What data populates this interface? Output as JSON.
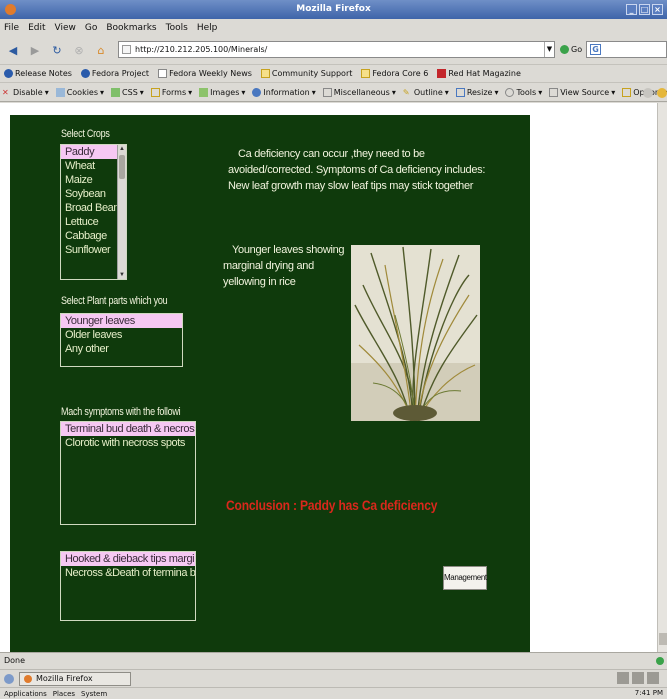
{
  "window": {
    "title": "Mozilla Firefox"
  },
  "menu": [
    "File",
    "Edit",
    "View",
    "Go",
    "Bookmarks",
    "Tools",
    "Help"
  ],
  "nav": {
    "url": "http://210.212.205.100/Minerals/",
    "go_label": "Go",
    "search_icon_label": "G"
  },
  "bookmarks": [
    "Release Notes",
    "Fedora Project",
    "Fedora Weekly News",
    "Community Support",
    "Fedora Core 6",
    "Red Hat Magazine"
  ],
  "devtoolbar": [
    "Disable",
    "Cookies",
    "CSS",
    "Forms",
    "Images",
    "Information",
    "Miscellaneous",
    "Outline",
    "Resize",
    "Tools",
    "View Source",
    "Options"
  ],
  "page": {
    "crops_label": "Select Crops",
    "crops": [
      "Paddy",
      "Wheat",
      "Maize",
      "Soybean",
      "Broad Bean",
      "Lettuce",
      "Cabbage",
      "Sunflower"
    ],
    "crops_selected": "Paddy",
    "parts_label": "Select Plant parts which you",
    "parts": [
      "Younger leaves",
      "Older leaves",
      "Any other"
    ],
    "parts_selected": "Younger leaves",
    "symptoms_label": "Mach symptoms with the followi",
    "symptoms": [
      "Terminal bud death & necross",
      "Clorotic with necross spots"
    ],
    "symptoms_selected": "Terminal bud death & necross",
    "symptoms2": [
      "Hooked & dieback tips margins",
      "Necross &Death of termina bud"
    ],
    "symptoms2_selected": "Hooked & dieback tips margins",
    "info_line1": "Ca deficiency can occur ,they need to be",
    "info_line2": "avoided/corrected. Symptoms of Ca deficiency includes:",
    "info_line3": "New leaf growth may slow  leaf tips may stick together",
    "caption_line1": "Younger leaves showing",
    "caption_line2": "marginal  drying and",
    "caption_line3": "yellowing in rice",
    "conclusion": "Conclusion : Paddy has Ca deficiency",
    "management_button": "Management"
  },
  "status": {
    "text": "Done"
  },
  "taskbar": {
    "window_button": "Mozilla Firefox",
    "panel_items": [
      "Applications",
      "Places",
      "System"
    ],
    "clock": "7:41 PM"
  },
  "colors": {
    "page_bg": "#0f3a0c",
    "selected": "#f6c8f3",
    "conclusion": "#d9281c"
  }
}
